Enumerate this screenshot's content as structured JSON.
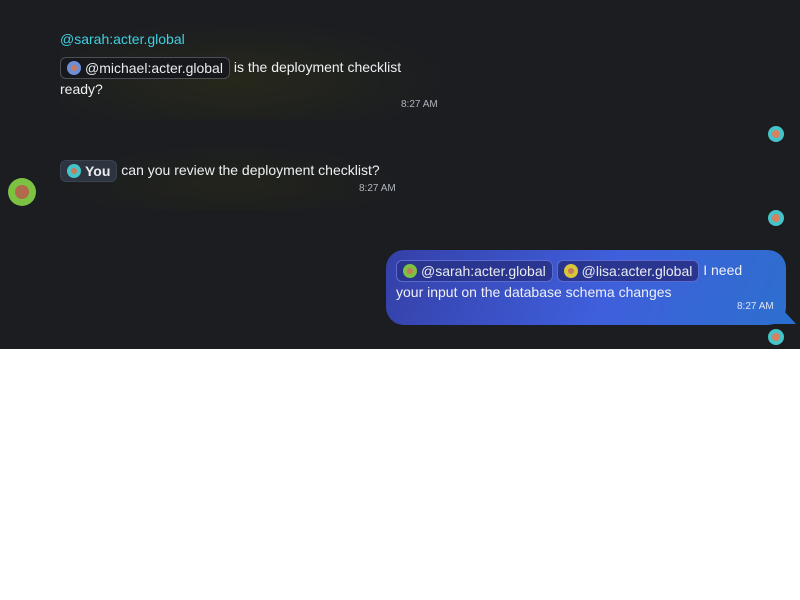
{
  "messages": [
    {
      "sender": "@sarah:acter.global",
      "mention": "@michael:acter.global",
      "text_line1": "is the deployment checklist",
      "text_line2": "ready?",
      "time": "8:27 AM"
    },
    {
      "mention": "You",
      "text": "can you review the deployment checklist?",
      "time": "8:27 AM"
    },
    {
      "mention1": "@sarah:acter.global",
      "mention2": "@lisa:acter.global",
      "text_line1": "I need",
      "text_line2": "your input on the database schema changes",
      "time": "8:27 AM"
    }
  ],
  "icons": {
    "mention_avatar": "user-avatar-icon",
    "read_receipt": "read-receipt-avatar-icon"
  },
  "colors": {
    "background": "#1b1d21",
    "sender_name": "#3fd0e0",
    "own_bubble_start": "#3540a8",
    "own_bubble_end": "#2d6fce"
  }
}
